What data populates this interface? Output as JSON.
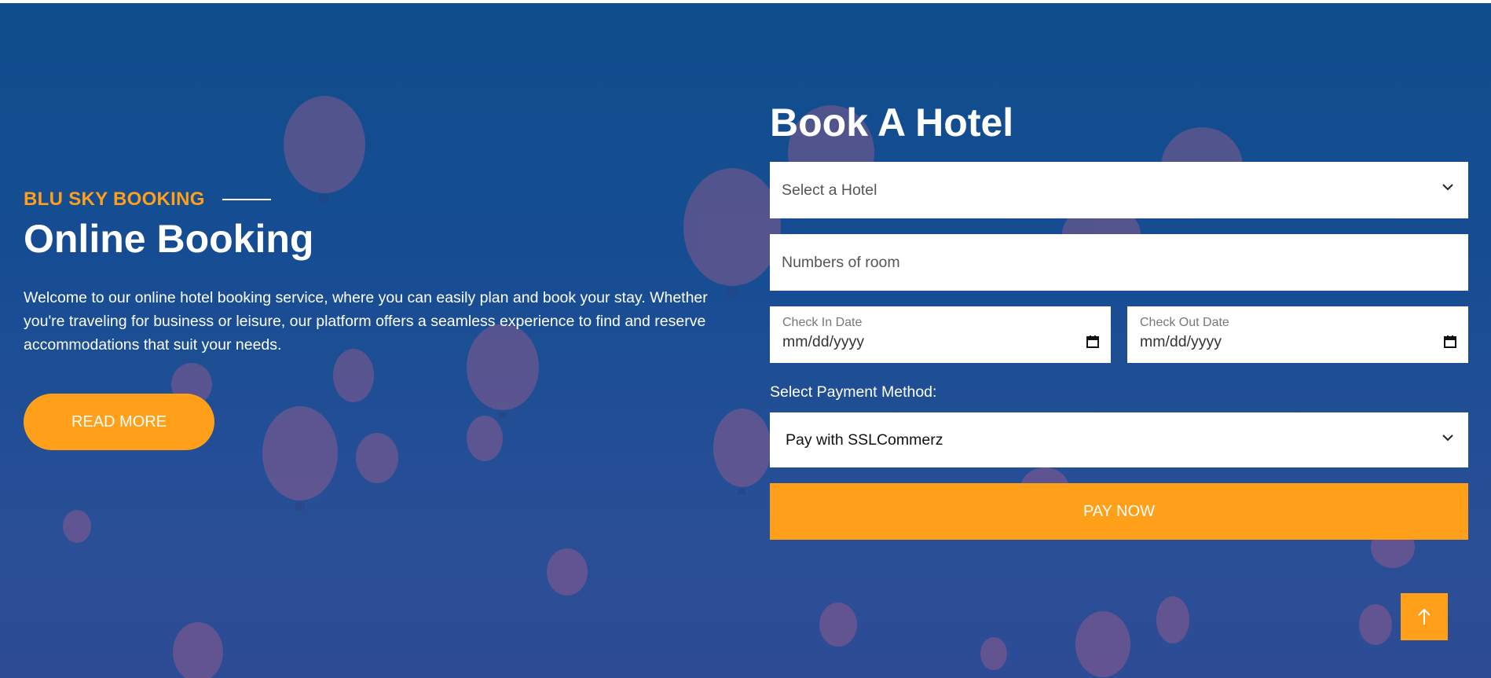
{
  "hero": {
    "eyebrow": "BLU SKY BOOKING",
    "title": "Online Booking",
    "intro": "Welcome to our online hotel booking service, where you can easily plan and book your stay. Whether you're traveling for business or leisure, our platform offers a seamless experience to find and reserve accommodations that suit your needs.",
    "read_more_label": "READ MORE"
  },
  "form": {
    "title": "Book A Hotel",
    "hotel_select_value": "Select a Hotel",
    "rooms_placeholder": "Numbers of room",
    "check_in_label": "Check In Date",
    "check_in_value": "mm/dd/yyyy",
    "check_out_label": "Check Out Date",
    "check_out_value": "mm/dd/yyyy",
    "payment_label": "Select Payment Method:",
    "payment_value": "Pay with SSLCommerz",
    "pay_button_label": "PAY NOW"
  },
  "icons": {
    "dropdown": "chevron-down-icon",
    "calendar": "calendar-icon",
    "scroll_top": "arrow-up-icon"
  },
  "colors": {
    "accent": "#ff9f1a",
    "background": "#174d93",
    "text_light": "#ffffff"
  }
}
